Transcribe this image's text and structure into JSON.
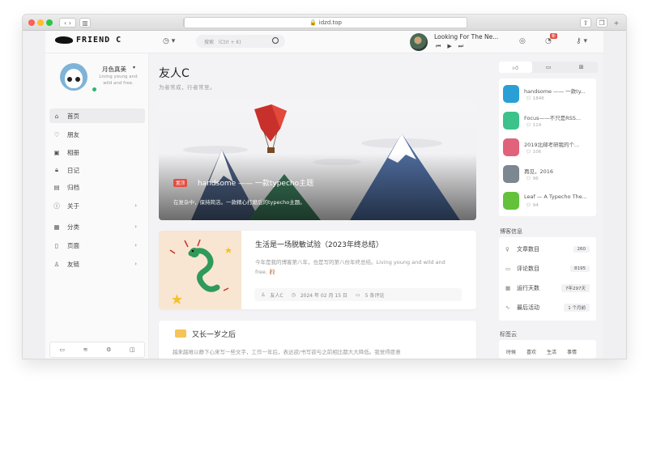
{
  "browser": {
    "url": "idzd.top"
  },
  "header": {
    "logo_text": "FRIEND C",
    "search_placeholder": "搜索  （Ctrl + K)",
    "music_title": "Looking For The Ne...",
    "message_badge": "新"
  },
  "sidebar": {
    "username": "月色真美",
    "motto": "Living young and wild and free.",
    "items": [
      {
        "label": "首页",
        "icon": "home-icon"
      },
      {
        "label": "朋友",
        "icon": "heart-icon"
      },
      {
        "label": "相册",
        "icon": "image-icon"
      },
      {
        "label": "日记",
        "icon": "lock-icon"
      },
      {
        "label": "归档",
        "icon": "archive-icon"
      },
      {
        "label": "关于",
        "icon": "info-icon"
      },
      {
        "label": "分类",
        "icon": "grid-icon"
      },
      {
        "label": "页面",
        "icon": "page-icon"
      },
      {
        "label": "友链",
        "icon": "user-icon"
      }
    ]
  },
  "main": {
    "title": "友人C",
    "subtitle": "为者常成，行者常至。",
    "hero": {
      "tag": "置顶",
      "title": "handsome —— 一款typecho主题",
      "desc": "在复杂中，保持简洁。一款精心打磨后的typecho主题。"
    },
    "post1": {
      "title": "生活是一场脱敏试验（2023年终总结）",
      "excerpt": "今年是我的博客第八年，也是写的第八份年终总结。Living young and wild and free. 🩰",
      "author": "友人C",
      "date": "2024 年 02 月 15 日",
      "comments": "5 条评论"
    },
    "post2": {
      "title": "又长一岁之后",
      "excerpt": "越来越难以静下心来写一些文字，工作一年后，表达欲/书写欲与之前相比都大大降低。我觉得愿意"
    }
  },
  "right": {
    "tabs": [
      "thumbs-up-icon",
      "comment-icon",
      "gift-icon"
    ],
    "hot": [
      {
        "title": "handsome —— 一款ty...",
        "count": "1846",
        "color": "#2a9fd6"
      },
      {
        "title": "Focus——不只是RSS...",
        "count": "114",
        "color": "#3cc28a"
      },
      {
        "title": "2019北邮考研我的个...",
        "count": "106",
        "color": "#e0637b"
      },
      {
        "title": "再见，2016",
        "count": "96",
        "color": "#7d8791"
      },
      {
        "title": "Leaf — A Typecho The...",
        "count": "94",
        "color": "#63c23a"
      }
    ],
    "stats_title": "博客信息",
    "stats": [
      {
        "label": "文章数目",
        "value": "260",
        "icon": "bulb-icon"
      },
      {
        "label": "评论数目",
        "value": "8195",
        "icon": "comment-icon"
      },
      {
        "label": "运行天数",
        "value": "7年297天",
        "icon": "calendar-icon"
      },
      {
        "label": "最后活动",
        "value": "1 个月前",
        "icon": "pulse-icon"
      }
    ],
    "tags_title": "标签云",
    "tags": [
      "时候",
      "喜欢",
      "生活",
      "事情"
    ]
  }
}
